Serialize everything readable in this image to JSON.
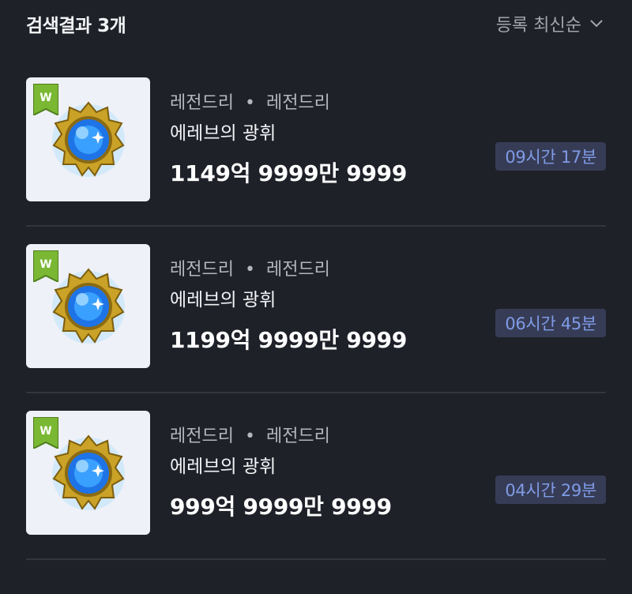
{
  "header": {
    "result_count": "검색결과 3개",
    "sort_label": "등록 최신순",
    "sort_icon": "chevron-down-icon"
  },
  "items": [
    {
      "badge": "W",
      "category_main": "레전드리",
      "separator": "•",
      "category_sub": "레전드리",
      "name": "에레브의 광휘",
      "price": "1149억 9999만 9999",
      "time_left": "09시간 17분"
    },
    {
      "badge": "W",
      "category_main": "레전드리",
      "separator": "•",
      "category_sub": "레전드리",
      "name": "에레브의 광휘",
      "price": "1199억 9999만 9999",
      "time_left": "06시간 45분"
    },
    {
      "badge": "W",
      "category_main": "레전드리",
      "separator": "•",
      "category_sub": "레전드리",
      "name": "에레브의 광휘",
      "price": "999억 9999만 9999",
      "time_left": "04시간 29분"
    }
  ],
  "colors": {
    "background": "#1f2129",
    "timer_bg": "#373c56",
    "timer_text": "#7f9be6",
    "badge_green": "#7ab834"
  }
}
